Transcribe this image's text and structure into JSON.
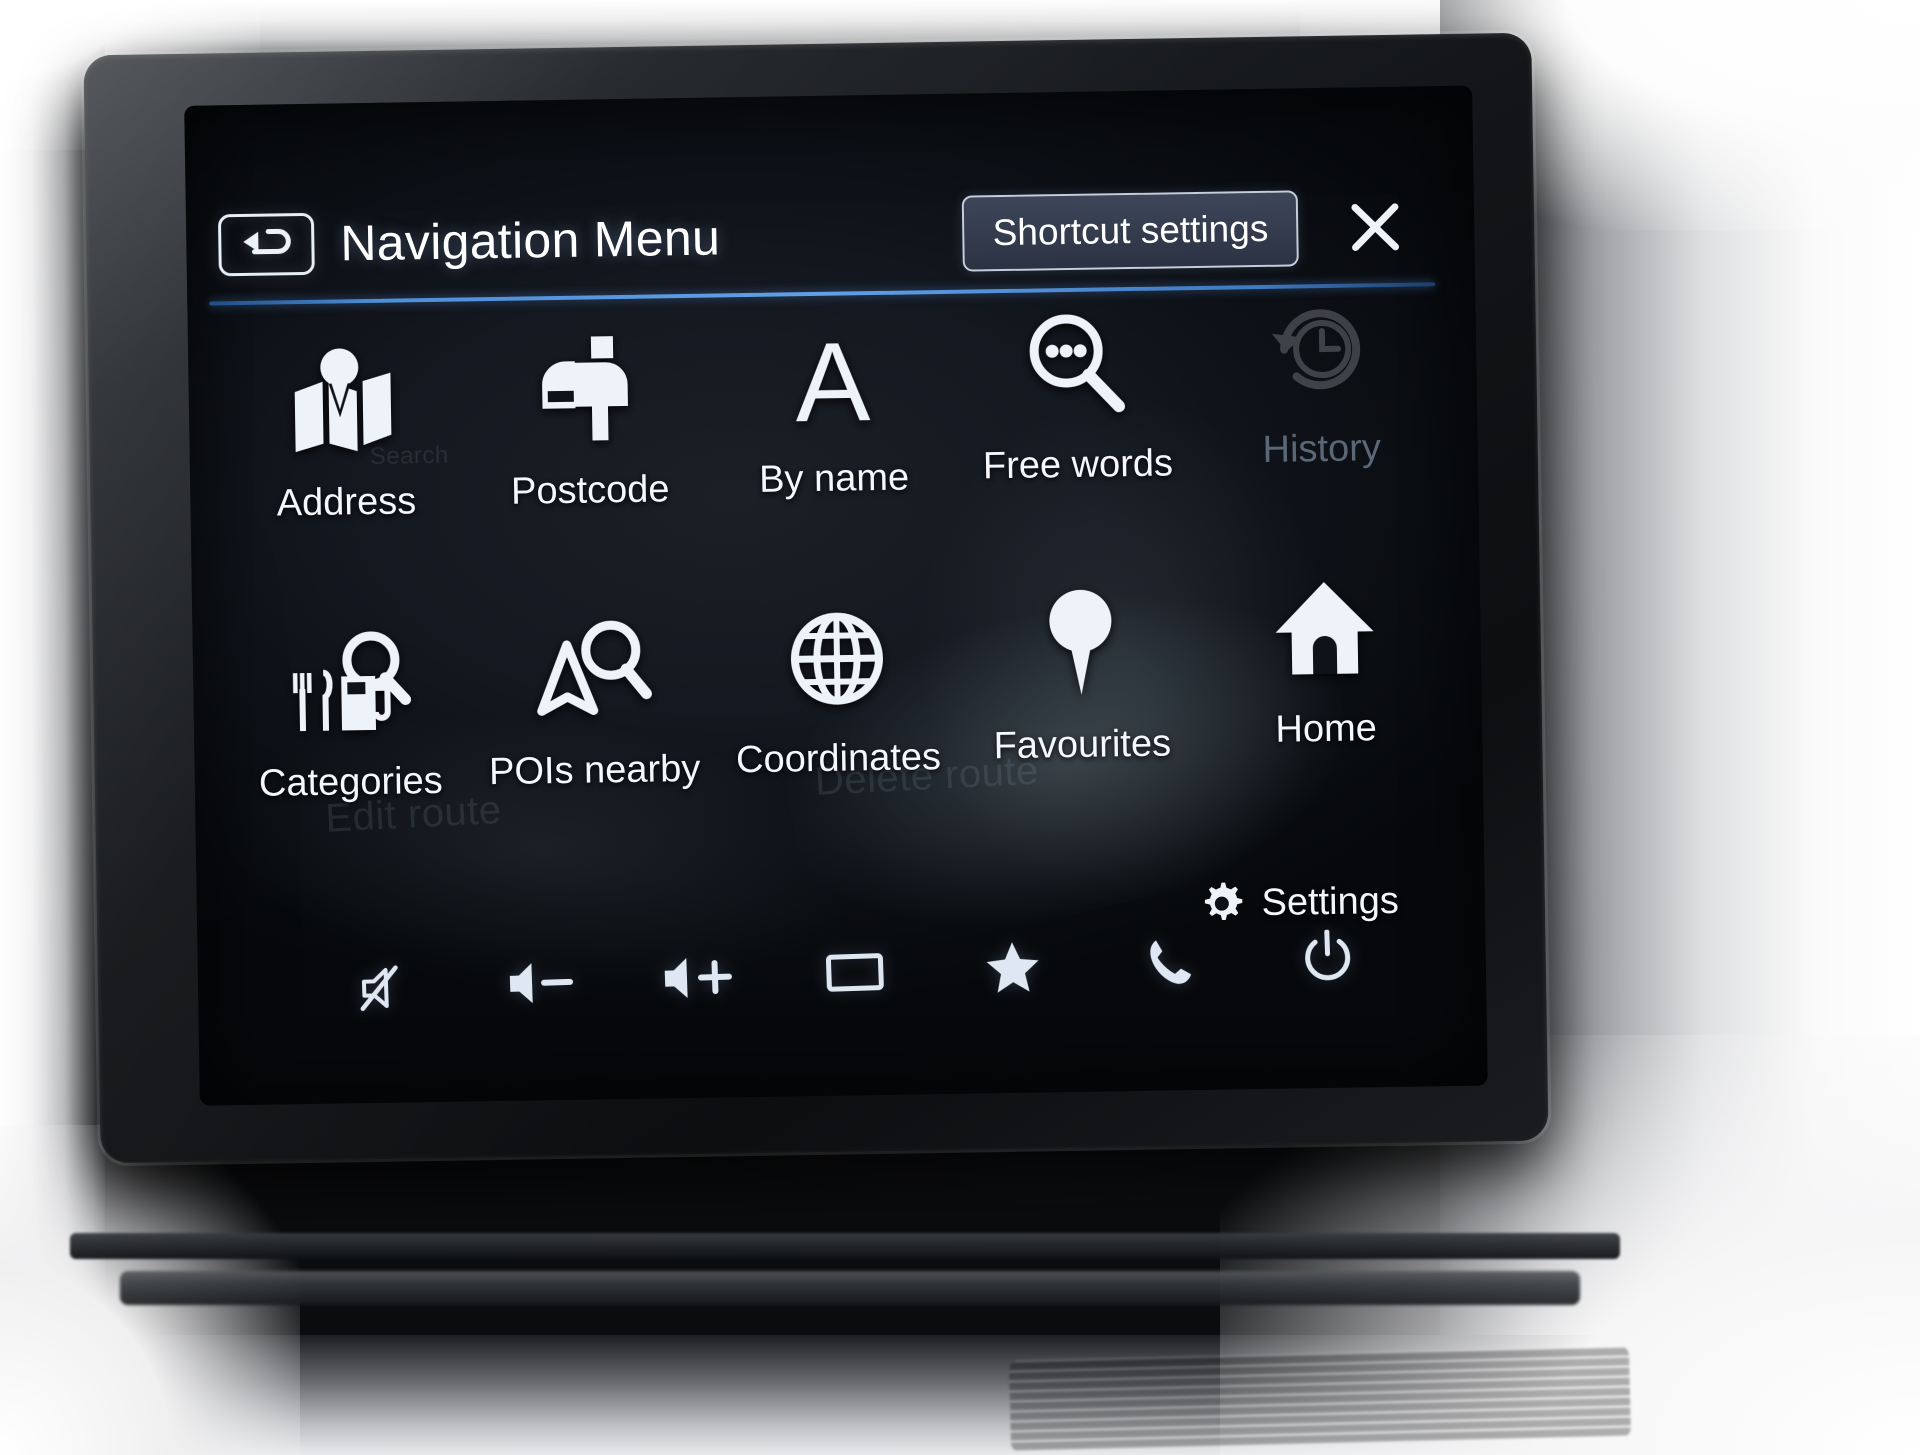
{
  "header": {
    "back_icon": "back-arrow-icon",
    "title": "Navigation Menu",
    "shortcut_label": "Shortcut settings",
    "close_icon": "close-icon"
  },
  "menu": {
    "tiles": [
      {
        "label": "Address",
        "icon": "map-person-icon",
        "enabled": true
      },
      {
        "label": "Postcode",
        "icon": "mailbox-icon",
        "enabled": true
      },
      {
        "label": "By name",
        "icon": "letter-a-icon",
        "enabled": true
      },
      {
        "label": "Free words",
        "icon": "magnifier-dots-icon",
        "enabled": true
      },
      {
        "label": "History",
        "icon": "clock-rewind-icon",
        "enabled": false
      },
      {
        "label": "Categories",
        "icon": "poi-category-search-icon",
        "enabled": true
      },
      {
        "label": "POIs nearby",
        "icon": "nav-arrow-search-icon",
        "enabled": true
      },
      {
        "label": "Coordinates",
        "icon": "globe-icon",
        "enabled": true
      },
      {
        "label": "Favourites",
        "icon": "map-pin-icon",
        "enabled": true
      },
      {
        "label": "Home",
        "icon": "home-icon",
        "enabled": true
      }
    ]
  },
  "settings": {
    "label": "Settings",
    "icon": "gear-icon"
  },
  "bottom_bar": {
    "buttons": [
      {
        "icon": "mute-icon",
        "name": "mute-button"
      },
      {
        "icon": "volume-down-icon",
        "name": "volume-down-button"
      },
      {
        "icon": "volume-up-icon",
        "name": "volume-up-button"
      },
      {
        "icon": "display-icon",
        "name": "display-button"
      },
      {
        "icon": "star-icon",
        "name": "favourite-button"
      },
      {
        "icon": "phone-icon",
        "name": "phone-button"
      },
      {
        "icon": "power-icon",
        "name": "power-button"
      }
    ]
  },
  "colors": {
    "accent_line": "#5fa0e6",
    "button_fill": "#343c4e",
    "button_border": "#c5cddb",
    "icon": "#eef3fa",
    "disabled": "#5b6676",
    "screen_bg": "#141820"
  },
  "ghosts": {
    "g1": "Edit route",
    "g2": "Delete route",
    "g3": "Search"
  }
}
